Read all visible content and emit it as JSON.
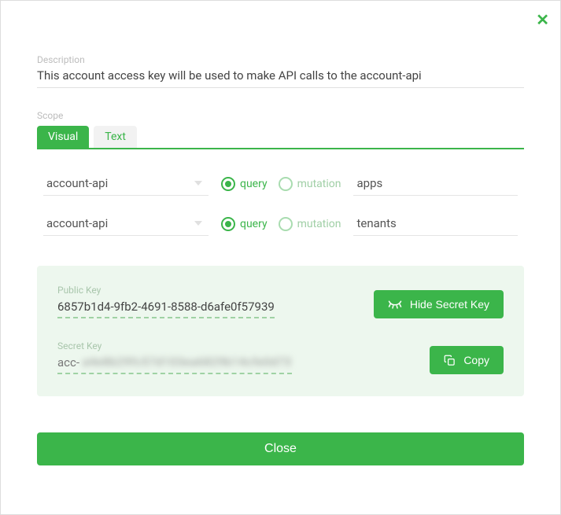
{
  "close_x": "✕",
  "description": {
    "label": "Description",
    "value": "This account access key will be used to make API calls to the account-api"
  },
  "scope": {
    "label": "Scope",
    "tabs": {
      "visual": "Visual",
      "text": "Text"
    },
    "rows": [
      {
        "service": "account-api",
        "query": "query",
        "mutation": "mutation",
        "name": "apps"
      },
      {
        "service": "account-api",
        "query": "query",
        "mutation": "mutation",
        "name": "tenants"
      }
    ]
  },
  "keys": {
    "public": {
      "label": "Public Key",
      "value": "6857b1d4-9fb2-4691-8588-d6afe0f57939"
    },
    "secret": {
      "label": "Secret Key",
      "prefix": "acc-",
      "masked": "a4e8b29fc57d103ea6829b14cfe0d73"
    }
  },
  "buttons": {
    "hide_secret": "Hide Secret Key",
    "copy": "Copy",
    "close": "Close"
  }
}
